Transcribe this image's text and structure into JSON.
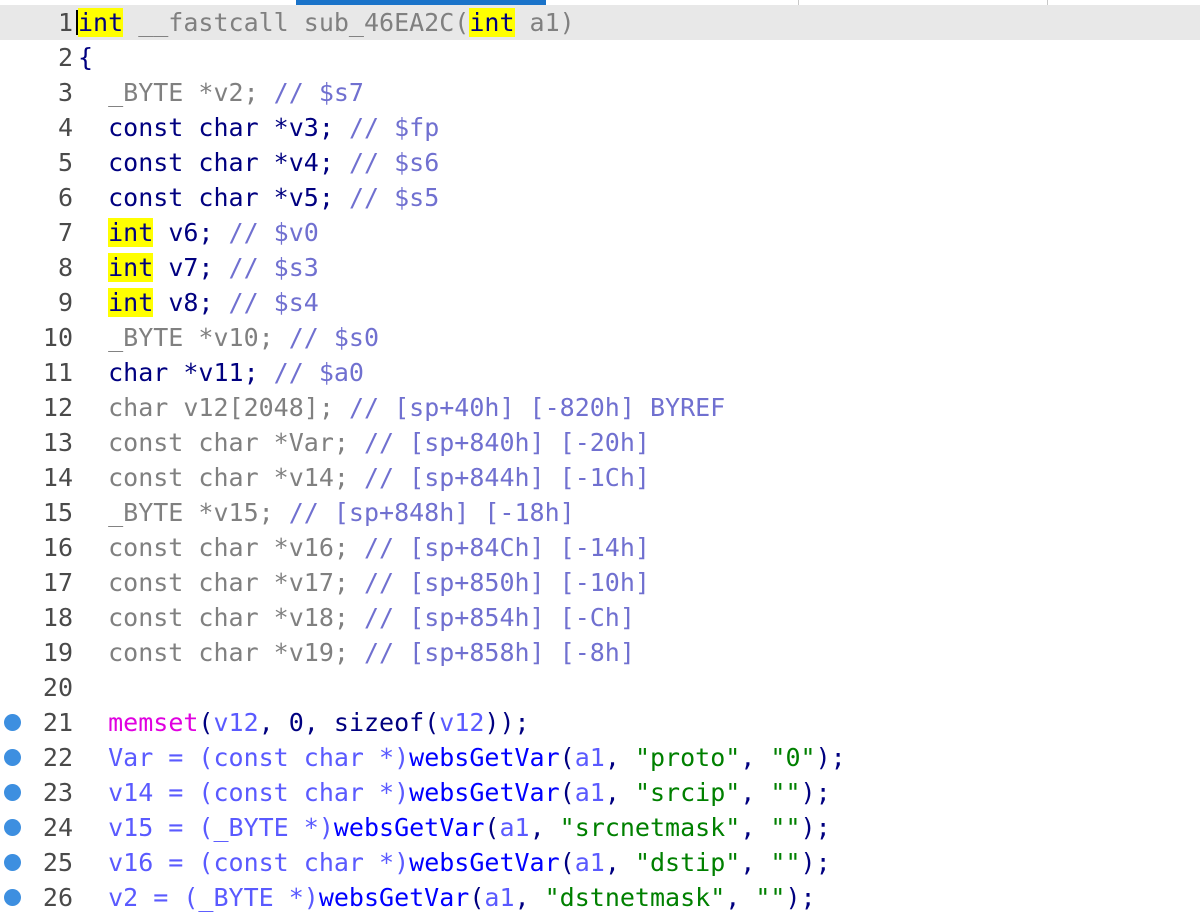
{
  "editor": {
    "lines": [
      {
        "num": "1",
        "current": true,
        "highlight_first": true,
        "tokens": [
          {
            "t": "int",
            "c": "kw",
            "hl": true
          },
          {
            "t": " __fastcall sub_46EA2C(",
            "c": "gray"
          },
          {
            "t": "int",
            "c": "kw",
            "hl": true
          },
          {
            "t": " a1)",
            "c": "gray"
          }
        ]
      },
      {
        "num": "2",
        "tokens": [
          {
            "t": "{",
            "c": "punct"
          }
        ]
      },
      {
        "num": "3",
        "tokens": [
          {
            "t": "  _BYTE *v2; ",
            "c": "gray"
          },
          {
            "t": "// $s7",
            "c": "cmt"
          }
        ]
      },
      {
        "num": "4",
        "tokens": [
          {
            "t": "  const char *v3; ",
            "c": "kw"
          },
          {
            "t": "// $fp",
            "c": "cmt"
          }
        ]
      },
      {
        "num": "5",
        "tokens": [
          {
            "t": "  const char *v4; ",
            "c": "kw"
          },
          {
            "t": "// $s6",
            "c": "cmt"
          }
        ]
      },
      {
        "num": "6",
        "tokens": [
          {
            "t": "  const char *v5; ",
            "c": "kw"
          },
          {
            "t": "// $s5",
            "c": "cmt"
          }
        ]
      },
      {
        "num": "7",
        "tokens": [
          {
            "t": "  ",
            "c": "kw"
          },
          {
            "t": "int",
            "c": "kw",
            "hl": true
          },
          {
            "t": " v6; ",
            "c": "kw"
          },
          {
            "t": "// $v0",
            "c": "cmt"
          }
        ]
      },
      {
        "num": "8",
        "tokens": [
          {
            "t": "  ",
            "c": "kw"
          },
          {
            "t": "int",
            "c": "kw",
            "hl": true
          },
          {
            "t": " v7; ",
            "c": "kw"
          },
          {
            "t": "// $s3",
            "c": "cmt"
          }
        ]
      },
      {
        "num": "9",
        "tokens": [
          {
            "t": "  ",
            "c": "kw"
          },
          {
            "t": "int",
            "c": "kw",
            "hl": true
          },
          {
            "t": " v8; ",
            "c": "kw"
          },
          {
            "t": "// $s4",
            "c": "cmt"
          }
        ]
      },
      {
        "num": "10",
        "tokens": [
          {
            "t": "  _BYTE *v10; ",
            "c": "gray"
          },
          {
            "t": "// $s0",
            "c": "cmt"
          }
        ]
      },
      {
        "num": "11",
        "tokens": [
          {
            "t": "  char *v11; ",
            "c": "kw"
          },
          {
            "t": "// $a0",
            "c": "cmt"
          }
        ]
      },
      {
        "num": "12",
        "tokens": [
          {
            "t": "  char v12[2048]; ",
            "c": "gray"
          },
          {
            "t": "// [sp+40h] [-820h] BYREF",
            "c": "cmt"
          }
        ]
      },
      {
        "num": "13",
        "tokens": [
          {
            "t": "  const char *Var; ",
            "c": "gray"
          },
          {
            "t": "// [sp+840h] [-20h]",
            "c": "cmt"
          }
        ]
      },
      {
        "num": "14",
        "tokens": [
          {
            "t": "  const char *v14; ",
            "c": "gray"
          },
          {
            "t": "// [sp+844h] [-1Ch]",
            "c": "cmt"
          }
        ]
      },
      {
        "num": "15",
        "tokens": [
          {
            "t": "  _BYTE *v15; ",
            "c": "gray"
          },
          {
            "t": "// [sp+848h] [-18h]",
            "c": "cmt"
          }
        ]
      },
      {
        "num": "16",
        "tokens": [
          {
            "t": "  const char *v16; ",
            "c": "gray"
          },
          {
            "t": "// [sp+84Ch] [-14h]",
            "c": "cmt"
          }
        ]
      },
      {
        "num": "17",
        "tokens": [
          {
            "t": "  const char *v17; ",
            "c": "gray"
          },
          {
            "t": "// [sp+850h] [-10h]",
            "c": "cmt"
          }
        ]
      },
      {
        "num": "18",
        "tokens": [
          {
            "t": "  const char *v18; ",
            "c": "gray"
          },
          {
            "t": "// [sp+854h] [-Ch]",
            "c": "cmt"
          }
        ]
      },
      {
        "num": "19",
        "tokens": [
          {
            "t": "  const char *v19; ",
            "c": "gray"
          },
          {
            "t": "// [sp+858h] [-8h]",
            "c": "cmt"
          }
        ]
      },
      {
        "num": "20",
        "tokens": []
      },
      {
        "num": "21",
        "bp": true,
        "tokens": [
          {
            "t": "  ",
            "c": "kw"
          },
          {
            "t": "memset",
            "c": "lib"
          },
          {
            "t": "(",
            "c": "punct"
          },
          {
            "t": "v12",
            "c": "var"
          },
          {
            "t": ", 0, sizeof(",
            "c": "punct"
          },
          {
            "t": "v12",
            "c": "var"
          },
          {
            "t": "));",
            "c": "punct"
          }
        ]
      },
      {
        "num": "22",
        "bp": true,
        "tokens": [
          {
            "t": "  Var = (const char *)",
            "c": "var"
          },
          {
            "t": "websGetVar",
            "c": "fn"
          },
          {
            "t": "(",
            "c": "punct"
          },
          {
            "t": "a1",
            "c": "var"
          },
          {
            "t": ", ",
            "c": "punct"
          },
          {
            "t": "\"proto\"",
            "c": "str"
          },
          {
            "t": ", ",
            "c": "punct"
          },
          {
            "t": "\"0\"",
            "c": "str"
          },
          {
            "t": ");",
            "c": "punct"
          }
        ]
      },
      {
        "num": "23",
        "bp": true,
        "tokens": [
          {
            "t": "  v14 = (const char *)",
            "c": "var"
          },
          {
            "t": "websGetVar",
            "c": "fn"
          },
          {
            "t": "(",
            "c": "punct"
          },
          {
            "t": "a1",
            "c": "var"
          },
          {
            "t": ", ",
            "c": "punct"
          },
          {
            "t": "\"srcip\"",
            "c": "str"
          },
          {
            "t": ", ",
            "c": "punct"
          },
          {
            "t": "\"\"",
            "c": "str"
          },
          {
            "t": ");",
            "c": "punct"
          }
        ]
      },
      {
        "num": "24",
        "bp": true,
        "tokens": [
          {
            "t": "  v15 = (_BYTE *)",
            "c": "var"
          },
          {
            "t": "websGetVar",
            "c": "fn"
          },
          {
            "t": "(",
            "c": "punct"
          },
          {
            "t": "a1",
            "c": "var"
          },
          {
            "t": ", ",
            "c": "punct"
          },
          {
            "t": "\"srcnetmask\"",
            "c": "str"
          },
          {
            "t": ", ",
            "c": "punct"
          },
          {
            "t": "\"\"",
            "c": "str"
          },
          {
            "t": ");",
            "c": "punct"
          }
        ]
      },
      {
        "num": "25",
        "bp": true,
        "tokens": [
          {
            "t": "  v16 = (const char *)",
            "c": "var"
          },
          {
            "t": "websGetVar",
            "c": "fn"
          },
          {
            "t": "(",
            "c": "punct"
          },
          {
            "t": "a1",
            "c": "var"
          },
          {
            "t": ", ",
            "c": "punct"
          },
          {
            "t": "\"dstip\"",
            "c": "str"
          },
          {
            "t": ", ",
            "c": "punct"
          },
          {
            "t": "\"\"",
            "c": "str"
          },
          {
            "t": ");",
            "c": "punct"
          }
        ]
      },
      {
        "num": "26",
        "bp": true,
        "tokens": [
          {
            "t": "  v2 = (_BYTE *)",
            "c": "var"
          },
          {
            "t": "websGetVar",
            "c": "fn"
          },
          {
            "t": "(",
            "c": "punct"
          },
          {
            "t": "a1",
            "c": "var"
          },
          {
            "t": ", ",
            "c": "punct"
          },
          {
            "t": "\"dstnetmask\"",
            "c": "str"
          },
          {
            "t": ", ",
            "c": "punct"
          },
          {
            "t": "\"\"",
            "c": "str"
          },
          {
            "t": ");",
            "c": "punct"
          }
        ]
      }
    ]
  }
}
